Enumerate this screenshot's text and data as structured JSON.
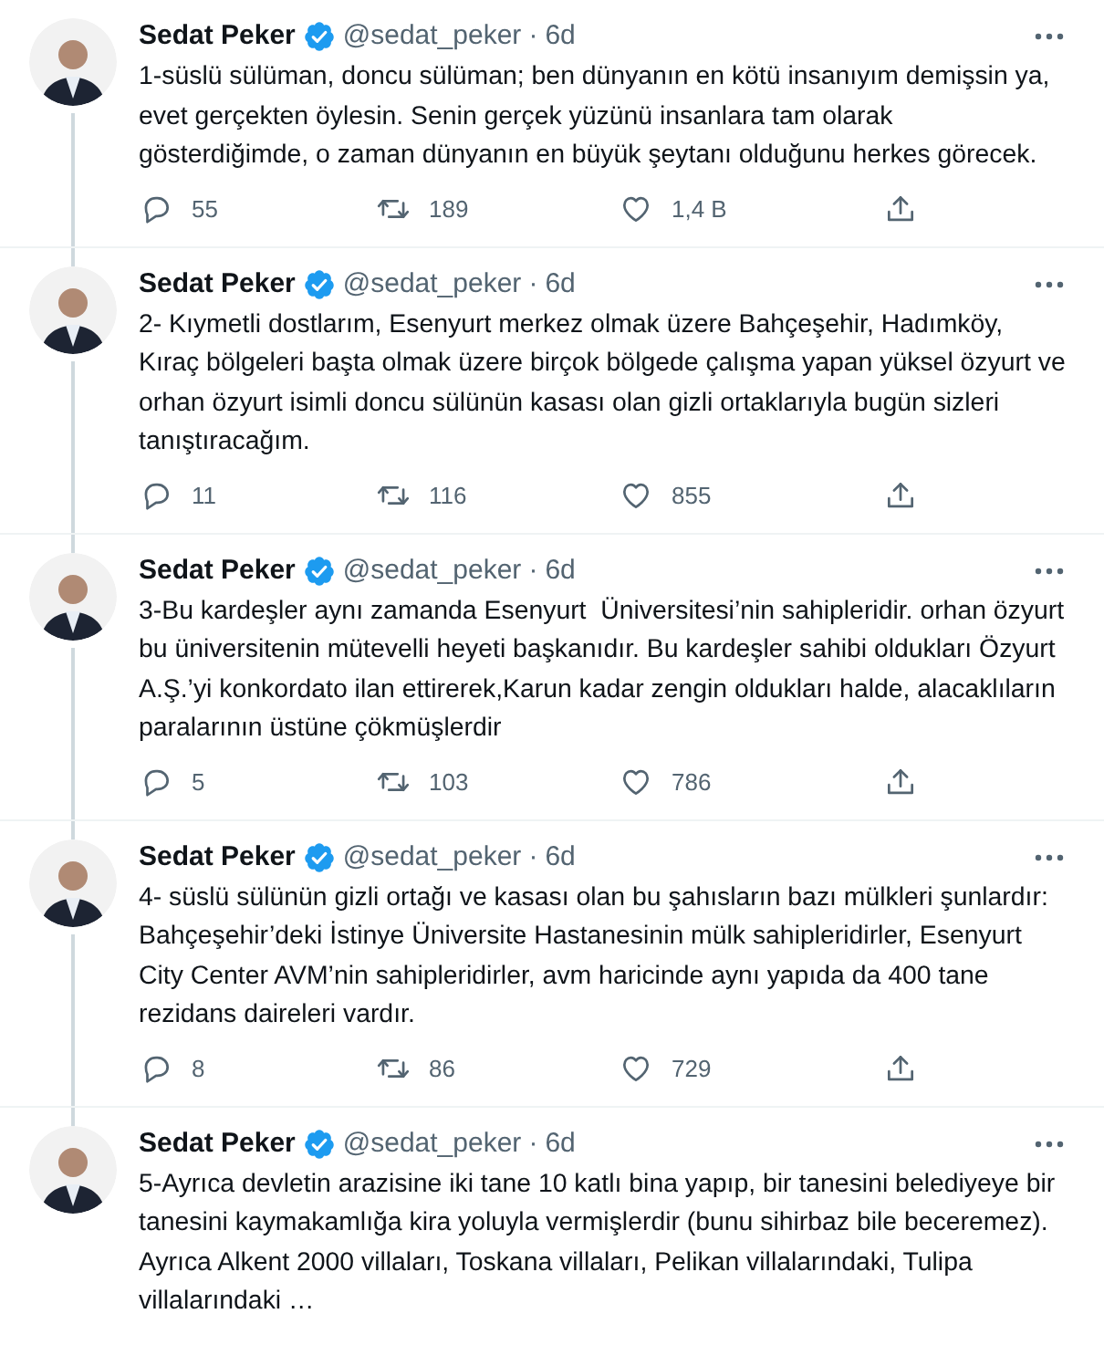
{
  "tweets": [
    {
      "name": "Sedat Peker",
      "verified": true,
      "handle": "@sedat_peker",
      "separator": "·",
      "time": "6d",
      "text": "1-süslü sülüman, doncu sülüman; ben dünyanın en kötü insanıyım demişsin ya, evet gerçekten öylesin. Senin gerçek yüzünü insanlara tam olarak gösterdiğimde, o zaman dünyanın en büyük şeytanı olduğunu herkes görecek.",
      "replies": "55",
      "retweets": "189",
      "likes": "1,4 B"
    },
    {
      "name": "Sedat Peker",
      "verified": true,
      "handle": "@sedat_peker",
      "separator": "·",
      "time": "6d",
      "text": "2- Kıymetli dostlarım, Esenyurt merkez olmak üzere Bahçeşehir, Hadımköy, Kıraç bölgeleri başta olmak üzere birçok bölgede çalışma yapan yüksel özyurt ve orhan özyurt isimli doncu sülünün kasası olan gizli ortaklarıyla bugün sizleri tanıştıracağım.",
      "replies": "11",
      "retweets": "116",
      "likes": "855"
    },
    {
      "name": "Sedat Peker",
      "verified": true,
      "handle": "@sedat_peker",
      "separator": "·",
      "time": "6d",
      "text": "3-Bu kardeşler aynı zamanda Esenyurt  Üniversitesi’nin sahipleridir. orhan özyurt bu üniversitenin mütevelli heyeti başkanıdır. Bu kardeşler sahibi oldukları Özyurt A.Ş.’yi konkordato ilan ettirerek,Karun kadar zengin oldukları halde, alacaklıların paralarının üstüne çökmüşlerdir",
      "replies": "5",
      "retweets": "103",
      "likes": "786"
    },
    {
      "name": "Sedat Peker",
      "verified": true,
      "handle": "@sedat_peker",
      "separator": "·",
      "time": "6d",
      "text": "4- süslü sülünün gizli ortağı ve kasası olan bu şahısların bazı mülkleri şunlardır: Bahçeşehir’deki İstinye Üniversite Hastanesinin mülk sahipleridirler, Esenyurt City Center AVM’nin sahipleridirler, avm haricinde aynı yapıda da 400 tane rezidans daireleri vardır.",
      "replies": "8",
      "retweets": "86",
      "likes": "729"
    },
    {
      "name": "Sedat Peker",
      "verified": true,
      "handle": "@sedat_peker",
      "separator": "·",
      "time": "6d",
      "text": "5-Ayrıca devletin arazisine iki tane 10 katlı bina yapıp, bir tanesini belediyeye bir tanesini kaymakamlığa kira yoluyla vermişlerdir (bunu sihirbaz bile beceremez).  Ayrıca Alkent 2000 villaları, Toskana villaları, Pelikan villalarındaki, Tulipa villalarındaki …"
    }
  ]
}
